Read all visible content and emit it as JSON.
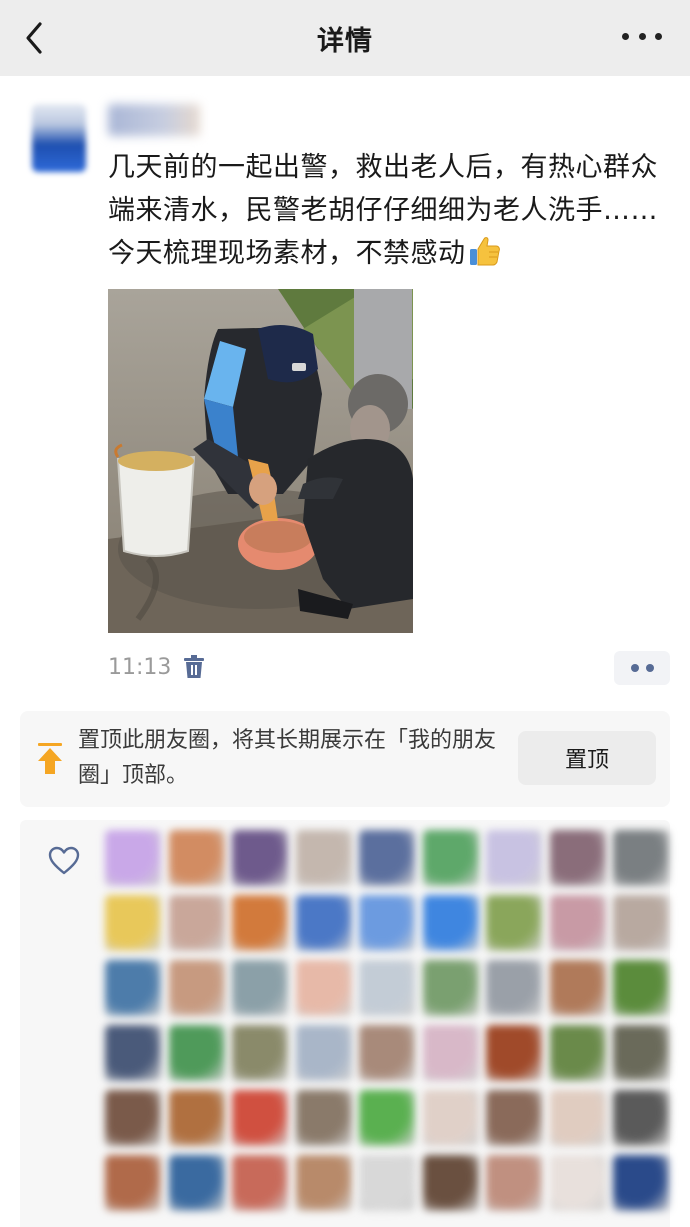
{
  "nav": {
    "title": "详情",
    "back_icon": "chevron-left-icon",
    "more_icon": "more-dots-icon"
  },
  "post": {
    "text": "几天前的一起出警，救出老人后，有热心群众端来清水，民警老胡仔仔细细为老人洗手……今天梳理现场素材，不禁感动",
    "emoji": "thumbs-up-emoji",
    "time": "11:13",
    "delete_icon": "trash-icon",
    "more_button_icon": "comment-dots-icon"
  },
  "pin": {
    "text": "置顶此朋友圈，将其长期展示在「我的朋友圈」顶部。",
    "button_label": "置顶",
    "icon": "pin-to-top-icon"
  },
  "likes": {
    "icon": "heart-outline-icon",
    "avatar_colors": [
      "#c9a8e8",
      "#d28c62",
      "#6e5a8c",
      "#c4b7ae",
      "#5b6f9e",
      "#5ea86a",
      "#c8c2e2",
      "#8a6d7a",
      "#7a7f82",
      "#e8c85a",
      "#c9a79a",
      "#d27a3c",
      "#4b78c6",
      "#6c9be0",
      "#3f86e0",
      "#8aa65b",
      "#c89aa5",
      "#b8a9a0",
      "#4d7caa",
      "#c79a80",
      "#8ba0a8",
      "#e7b9a8",
      "#c3ccd6",
      "#7aa070",
      "#9aa0a8",
      "#b07a5a",
      "#5b8c3c",
      "#4a5a7a",
      "#4f9a5a",
      "#8a8a6a",
      "#a9b6c8",
      "#a88a7a",
      "#d8b8c8",
      "#a04a2a",
      "#6a8a4a",
      "#6a6a5a",
      "#7a5a4a",
      "#b07040",
      "#d05040",
      "#8a7a6a",
      "#5ab050",
      "#e0d0c8",
      "#8a6a5a",
      "#e0ccc0",
      "#5a5a5a",
      "#b06a4a",
      "#3a6aa0",
      "#c86a5a",
      "#b88a6a",
      "#d8d8d8",
      "#6a5040",
      "#c09080",
      "#e8e0dc",
      "#2a4a8a"
    ]
  }
}
